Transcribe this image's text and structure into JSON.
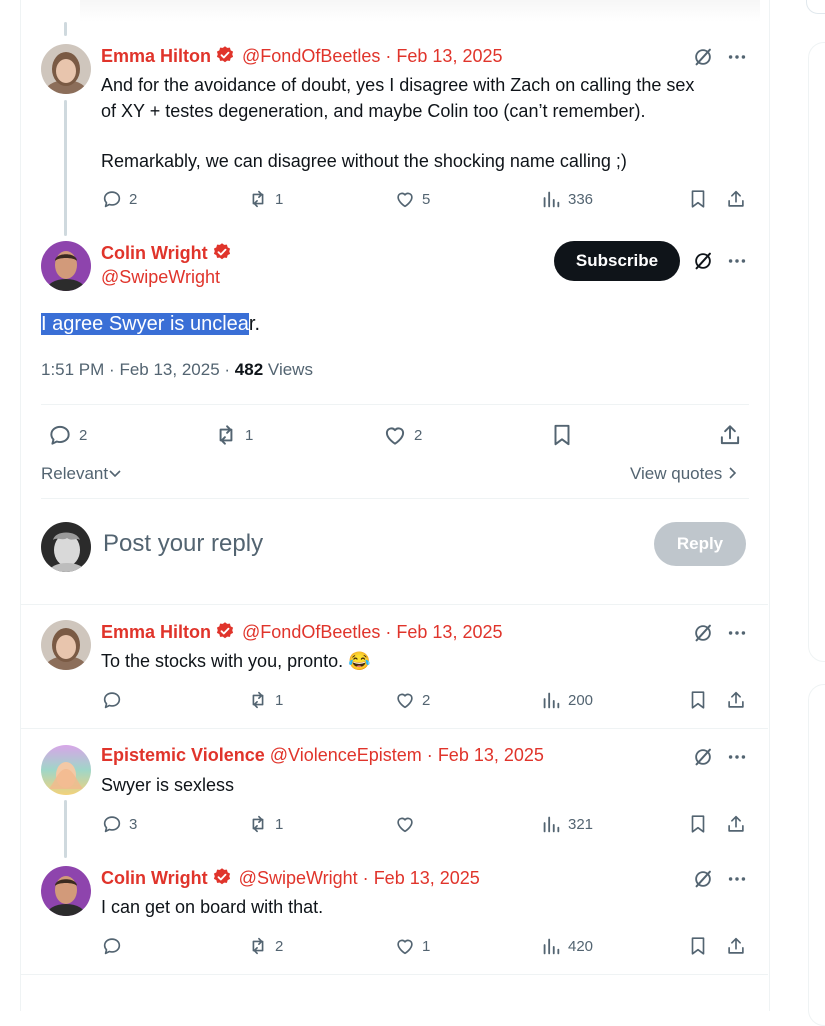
{
  "colors": {
    "accent": "#e0342b",
    "highlight": "#3a6fd6",
    "text": "#0f1419",
    "muted": "#536471"
  },
  "reply1": {
    "name": "Emma Hilton",
    "handle": "@FondOfBeetles",
    "dot": "·",
    "date": "Feb 13, 2025",
    "line1": "And for the avoidance of doubt, yes I disagree with Zach on calling the sex",
    "line2": "of XY + testes degeneration, and maybe Colin too (can’t remember).",
    "line3": "Remarkably, we can disagree without the shocking name calling ;)",
    "replies": "2",
    "reposts": "1",
    "likes": "5",
    "views": "336"
  },
  "main": {
    "name": "Colin Wright",
    "handle": "@SwipeWright",
    "subscribe": "Subscribe",
    "text_selected": "I agree Swyer is unclea",
    "text_rest": "r.",
    "time": "1:51 PM",
    "dot": "·",
    "date": "Feb 13, 2025",
    "dot2": "·",
    "views_count": "482",
    "views_label": "Views",
    "replies": "2",
    "reposts": "1",
    "likes": "2",
    "sort": "Relevant",
    "view_quotes": "View quotes"
  },
  "composer": {
    "placeholder": "Post your reply",
    "reply_button": "Reply"
  },
  "comments": [
    {
      "name": "Emma Hilton",
      "handle": "@FondOfBeetles",
      "dot": "·",
      "date": "Feb 13, 2025",
      "text": "To the stocks with you, pronto. 😂",
      "replies": "",
      "reposts": "1",
      "likes": "2",
      "views": "200"
    },
    {
      "name": "Epistemic Violence",
      "handle": "@ViolenceEpistem",
      "dot": "·",
      "date": "Feb 13, 2025",
      "text": "Swyer is sexless",
      "replies": "3",
      "reposts": "1",
      "likes": "",
      "views": "321"
    },
    {
      "name": "Colin Wright",
      "handle": "@SwipeWright",
      "dot": "·",
      "date": "Feb 13, 2025",
      "text": "I can get on board with that.",
      "replies": "",
      "reposts": "2",
      "likes": "1",
      "views": "420"
    }
  ],
  "icons": [
    "reply-icon",
    "repost-icon",
    "like-icon",
    "views-icon",
    "bookmark-icon",
    "share-icon",
    "grok-icon",
    "more-icon",
    "verified-icon",
    "chevron-down-icon",
    "chevron-right-icon"
  ]
}
